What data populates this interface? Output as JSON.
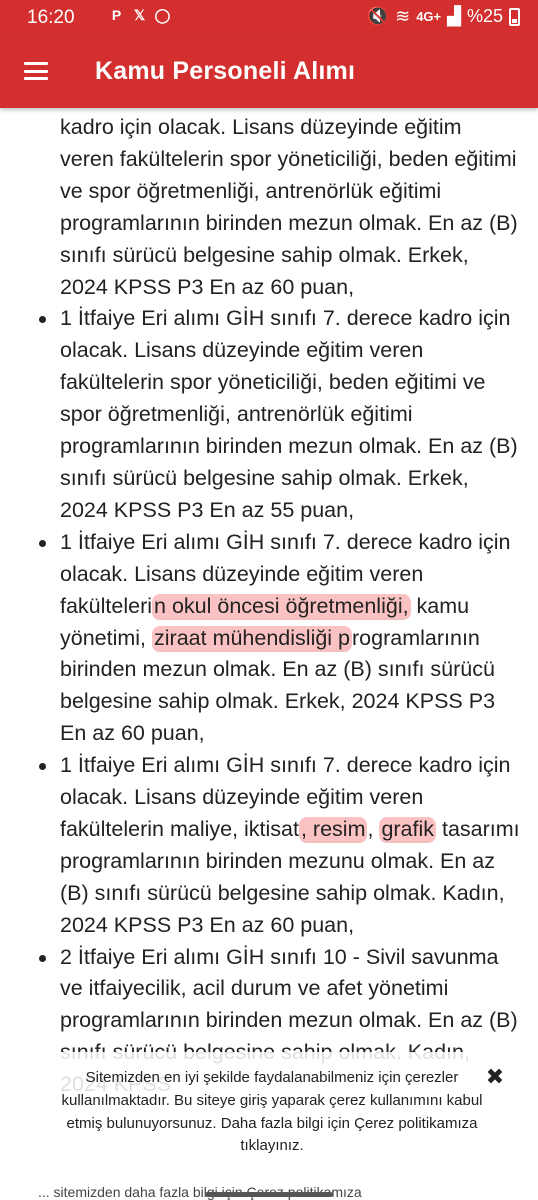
{
  "status_bar": {
    "time": "16:20",
    "app_icons": [
      "pinterest-icon",
      "x-icon",
      "whatsapp-icon"
    ],
    "network_label": "4G+",
    "battery": "%25"
  },
  "app_bar": {
    "menu_icon": "hamburger-menu-icon",
    "title": "Kamu Personeli Alımı",
    "color": "#d32f2f"
  },
  "content": {
    "first_paragraph": "kadro için olacak. Lisans düzeyinde eğitim veren fakültelerin spor yöneticiliği, beden eğitimi ve spor öğretmenliği, antrenörlük eğitimi programlarının birinden mezun olmak. En az (B) sınıfı sürücü belgesine sahip olmak. Erkek, 2024 KPSS P3 En az 60 puan,",
    "items": [
      {
        "text": "1 İtfaiye Eri alımı GİH sınıfı 7. derece kadro için olacak. Lisans düzeyinde eğitim veren fakültelerin spor yöneticiliği, beden eğitimi ve spor öğretmenliği, antrenörlük eğitimi programlarının birinden mezun olmak. En az (B) sınıfı sürücü belgesine sahip olmak. Erkek, 2024 KPSS P3 En az 55 puan,"
      },
      {
        "before_hl1": "1 İtfaiye Eri alımı GİH sınıfı 7. derece kadro için olacak. Lisans düzeyinde eğitim veren fakülteleri",
        "hl1": "n okul öncesi öğretmenliği,",
        "between": " kamu yönetimi, ",
        "hl2": "ziraat mühendisliği p",
        "after": "rogramlarının birinden mezun olmak. En az (B) sınıfı sürücü belgesine sahip olmak. Erkek, 2024 KPSS P3 En az 60 puan,"
      },
      {
        "before_hl1": "1 İtfaiye Eri alımı GİH sınıfı 7. derece kadro için olacak. Lisans düzeyinde eğitim veren fakültelerin maliye, iktisat",
        "hl1": ", resim",
        "between": ", ",
        "hl2": "grafik",
        "after": " tasarımı programlarının birinden mezunu olmak. En az (B) sınıfı sürücü belgesine sahip olmak. Kadın, 2024 KPSS P3 En az 60 puan,"
      },
      {
        "text": "2 İtfaiye Eri alımı GİH sınıfı 10 - Sivil savunma ve itfaiyecilik, acil durum ve afet yönetimi programlarının birinden mezun olmak. En az (B) sınıfı sürücü belgesine sahip olmak. Kadın, 2024 KPSS"
      }
    ],
    "highlight_color": "#f47878"
  },
  "cookie_banner": {
    "text": "Sitemizden en iyi şekilde faydalanabilmeniz için çerezler kullanılmaktadır. Bu siteye giriş yaparak çerez kullanımını kabul etmiş bulunuyorsunuz. Daha fazla bilgi için Çerez politikamıza tıklayınız.",
    "close_symbol": "✖"
  },
  "bottom_strip_text": "... sitemizden daha fazla bilgi için Çerez politikamıza"
}
